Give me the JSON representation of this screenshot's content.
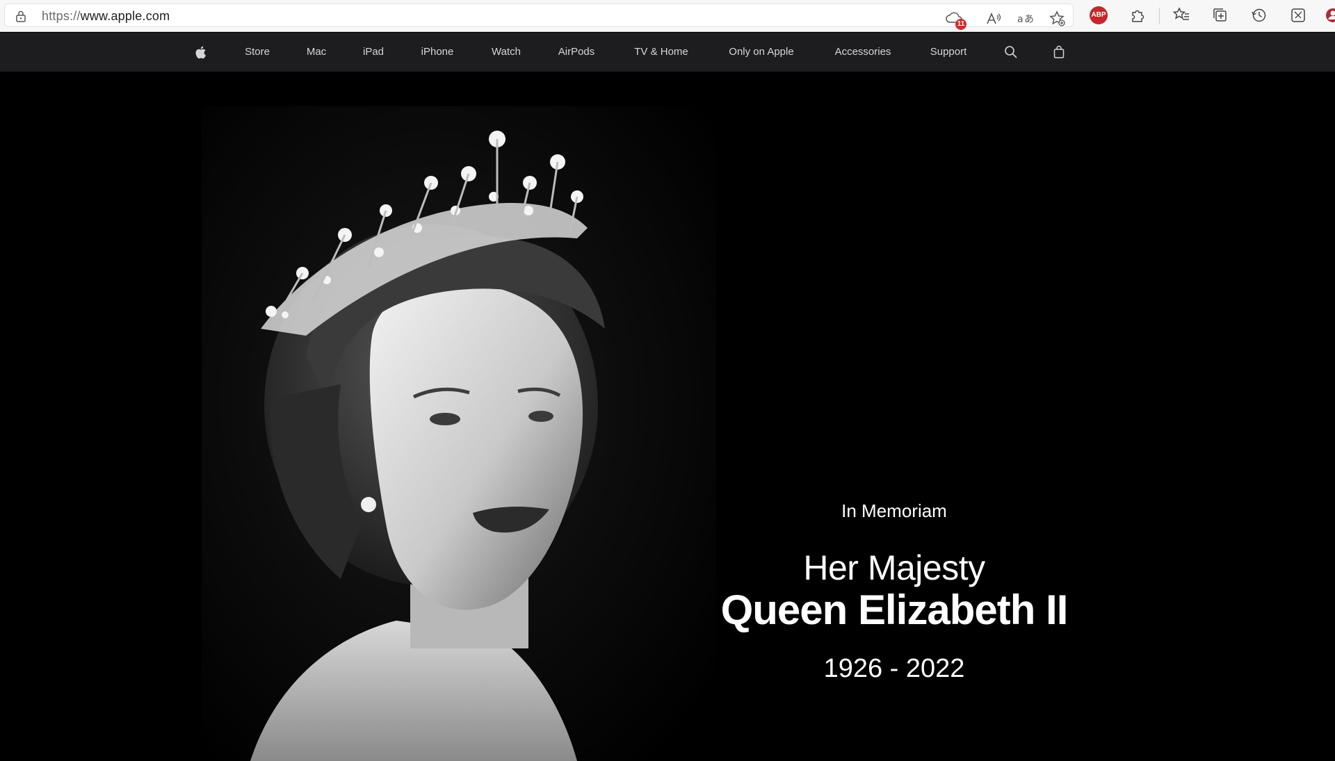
{
  "browser": {
    "url_scheme": "https://",
    "url_host": "www.apple.com",
    "tracker_count": "11",
    "adblock_label": "ABP"
  },
  "nav": {
    "items": [
      "Store",
      "Mac",
      "iPad",
      "iPhone",
      "Watch",
      "AirPods",
      "TV & Home",
      "Only on Apple",
      "Accessories",
      "Support"
    ]
  },
  "hero": {
    "eyebrow": "In Memoriam",
    "line1": "Her Majesty",
    "line2": "Queen Elizabeth II",
    "years": "1926 - 2022"
  }
}
